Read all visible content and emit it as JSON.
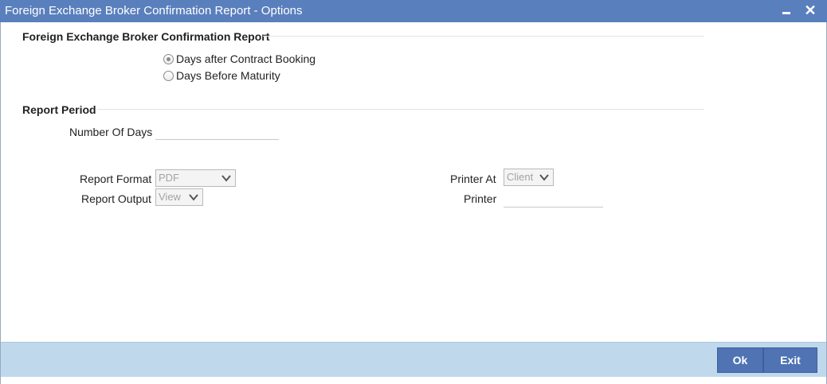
{
  "window": {
    "title": "Foreign Exchange Broker Confirmation Report - Options"
  },
  "section_report": {
    "title": "Foreign Exchange Broker Confirmation Report",
    "options": [
      {
        "label": "Days after Contract Booking",
        "checked": true
      },
      {
        "label": "Days Before Maturity",
        "checked": false
      }
    ]
  },
  "section_period": {
    "title": "Report Period",
    "number_of_days_label": "Number Of Days",
    "number_of_days_value": ""
  },
  "report_settings": {
    "format_label": "Report Format",
    "format_value": "PDF",
    "output_label": "Report Output",
    "output_value": "View",
    "printer_at_label": "Printer At",
    "printer_at_value": "Client",
    "printer_label": "Printer",
    "printer_value": ""
  },
  "footer": {
    "ok_label": "Ok",
    "exit_label": "Exit"
  }
}
